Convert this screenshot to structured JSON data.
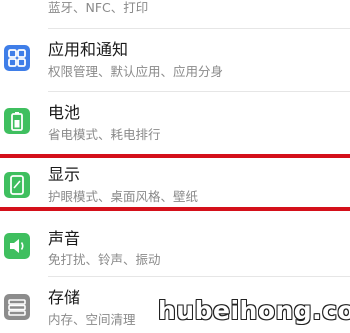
{
  "settings": {
    "items": [
      {
        "title": "",
        "subtitle": "蓝牙、NFC、打印",
        "icon": "connected-devices-icon"
      },
      {
        "title": "应用和通知",
        "subtitle": "权限管理、默认应用、应用分身",
        "icon": "apps-grid-icon",
        "color": "#3f7ee8"
      },
      {
        "title": "电池",
        "subtitle": "省电模式、耗电排行",
        "icon": "battery-icon",
        "color": "#3fbf5f"
      },
      {
        "title": "显示",
        "subtitle": "护眼模式、桌面风格、壁纸",
        "icon": "display-icon",
        "color": "#3fbf5f"
      },
      {
        "title": "声音",
        "subtitle": "免打扰、铃声、振动",
        "icon": "speaker-icon",
        "color": "#3fbf5f"
      },
      {
        "title": "存储",
        "subtitle": "内存、空间清理",
        "icon": "storage-icon",
        "color": "#8c8c8c"
      }
    ]
  },
  "highlight_color": "#d4101a",
  "watermark": "hubeihong.com"
}
